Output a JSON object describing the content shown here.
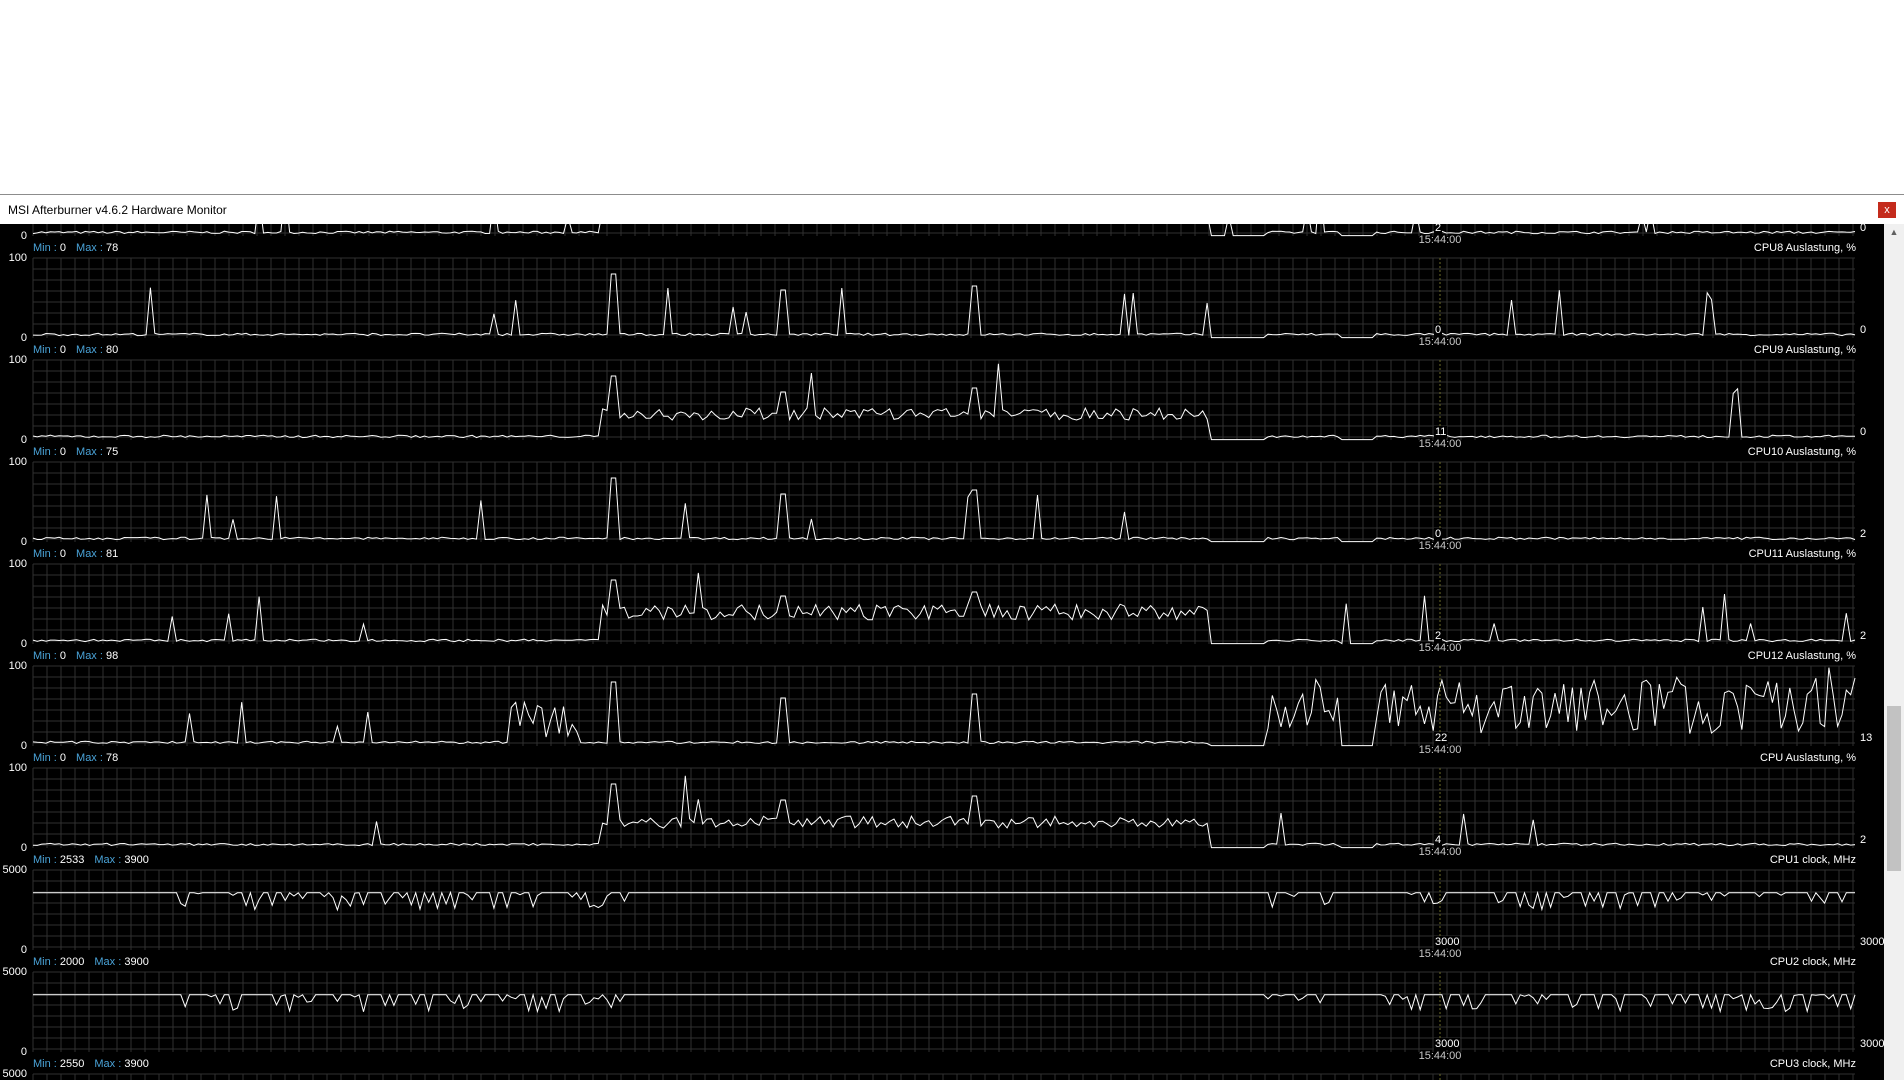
{
  "window": {
    "title": "MSI Afterburner v4.6.2 Hardware Monitor",
    "close_label": "x"
  },
  "colors": {
    "background": "#000000",
    "grid": "#303030",
    "line": "#ffffff",
    "minmax_key": "#4aa3d8",
    "cursor": "#6b6b2a"
  },
  "icons": {
    "scroll_up": "triangle-up-icon"
  },
  "graphs": [
    {
      "name": "CPU8 Auslastung, %",
      "min": "0",
      "max": "78",
      "axis_top": "",
      "axis_bottom": "0",
      "right_value": "0",
      "cursor_value": "2",
      "time": "15:44:00",
      "visible_top": false
    },
    {
      "name": "CPU9 Auslastung, %",
      "min": "0",
      "max": "80",
      "axis_top": "100",
      "axis_bottom": "0",
      "right_value": "0",
      "cursor_value": "0",
      "time": "15:44:00"
    },
    {
      "name": "CPU10 Auslastung, %",
      "min": "0",
      "max": "75",
      "axis_top": "100",
      "axis_bottom": "0",
      "right_value": "0",
      "cursor_value": "11",
      "time": "15:44:00"
    },
    {
      "name": "CPU11 Auslastung, %",
      "min": "0",
      "max": "81",
      "axis_top": "100",
      "axis_bottom": "0",
      "right_value": "2",
      "cursor_value": "0",
      "time": "15:44:00"
    },
    {
      "name": "CPU12 Auslastung, %",
      "min": "0",
      "max": "98",
      "axis_top": "100",
      "axis_bottom": "0",
      "right_value": "2",
      "cursor_value": "2",
      "time": "15:44:00"
    },
    {
      "name": "CPU Auslastung, %",
      "min": "0",
      "max": "78",
      "axis_top": "100",
      "axis_bottom": "0",
      "right_value": "13",
      "cursor_value": "22",
      "time": "15:44:00"
    },
    {
      "name": "CPU1 clock, MHz",
      "min": "2533",
      "max": "3900",
      "axis_top": "100",
      "axis_bottom": "0",
      "right_value": "2",
      "cursor_value": "4",
      "time": "15:44:00"
    },
    {
      "name": "CPU2 clock, MHz",
      "min": "2000",
      "max": "3900",
      "axis_top": "5000",
      "axis_bottom": "0",
      "right_value": "3000",
      "cursor_value": "3000",
      "time": "15:44:00"
    },
    {
      "name": "CPU3 clock, MHz",
      "min": "2550",
      "max": "3900",
      "axis_top": "5000",
      "axis_bottom": "0",
      "right_value": "3000",
      "cursor_value": "3000",
      "time": "15:44:00"
    },
    {
      "name": "",
      "min": "",
      "max": "",
      "axis_top": "5000",
      "axis_bottom": "",
      "right_value": "",
      "cursor_value": "",
      "time": ""
    }
  ],
  "labels": {
    "min": "Min : ",
    "max": "Max : "
  }
}
